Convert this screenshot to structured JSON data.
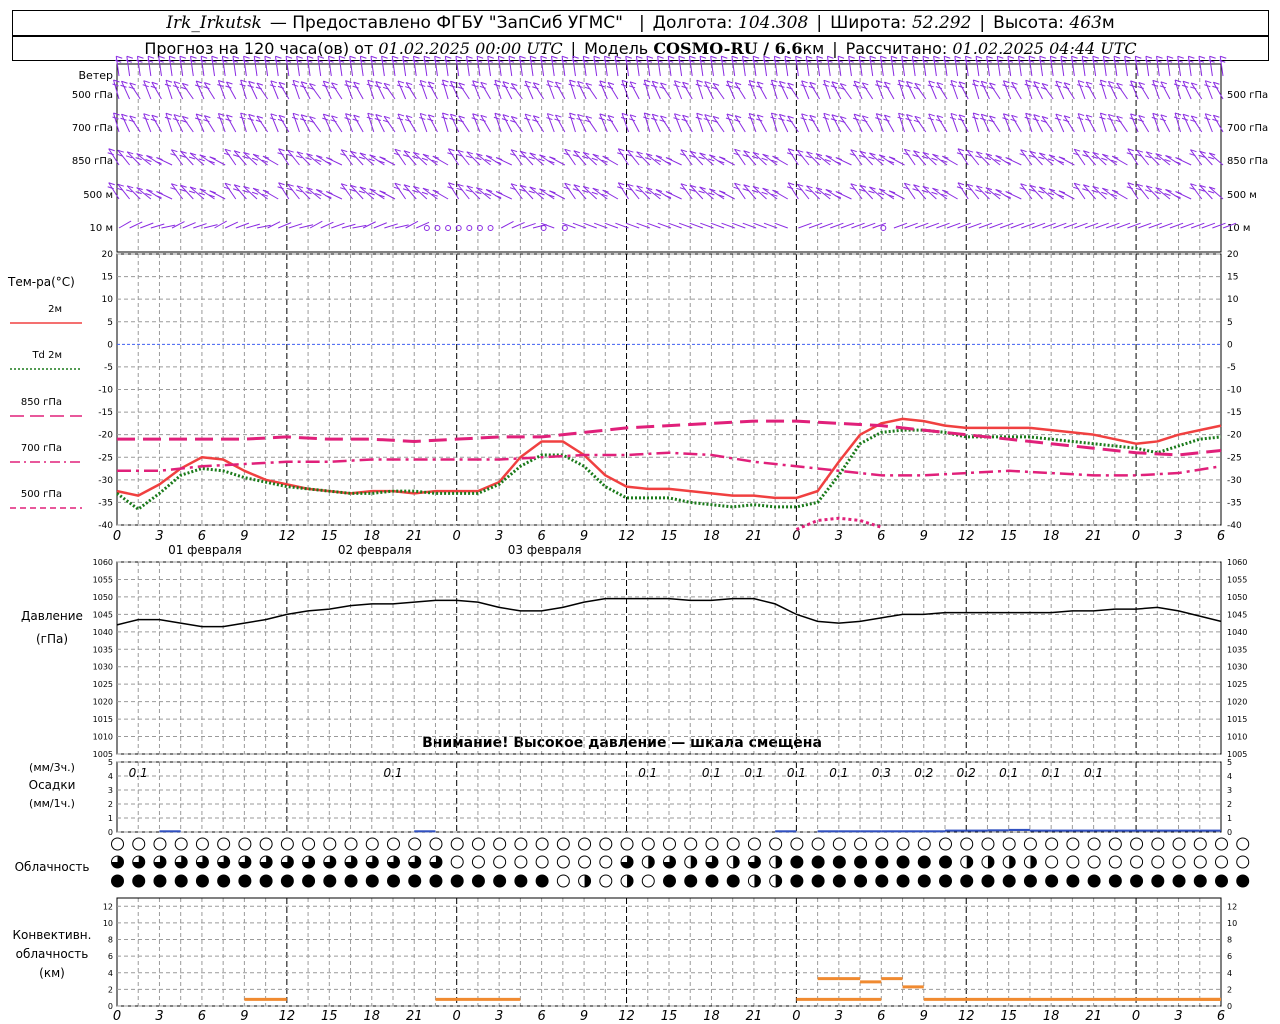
{
  "header": {
    "station": "Irk_Irkutsk",
    "provider": "— Предоставлено ФГБУ \"ЗапСиб УГМС\"",
    "lon_label": "Долгота:",
    "lon_value": "104.308",
    "lat_label": "Широта:",
    "lat_value": "52.292",
    "alt_label": "Высота:",
    "alt_value": "463",
    "alt_unit": "м",
    "forecast_label": "Прогноз на 120 часа(ов) от",
    "forecast_start": "01.02.2025 00:00 UTC",
    "model_label": "Модель",
    "model_value": "COSMO-RU / 6.6",
    "model_unit": "км",
    "computed_label": "Рассчитано:",
    "computed_value": "01.02.2025 04:44 UTC"
  },
  "colors": {
    "t2m": "#f04040",
    "td2m": "#1a7a1a",
    "t850": "#e0207a",
    "t700": "#e0207a",
    "t500": "#e0207a",
    "wind": "#8a2be2",
    "zero_line": "#4060f0",
    "pressure": "#000000",
    "precip": "#3050c0",
    "convective": "#f08a30"
  },
  "wind_panel": {
    "title": "Ветер",
    "levels": [
      "500 гПа",
      "700 гПа",
      "850 гПа",
      "500 м",
      "10  м"
    ],
    "levels_right": [
      "500 гПа",
      "700 гПа",
      "850 гПа",
      "500 м",
      "10  м"
    ]
  },
  "temp_panel": {
    "title": "Тем-ра(°C)",
    "legend": [
      {
        "label": "2м",
        "style": "solid",
        "color_key": "t2m"
      },
      {
        "label": "Td  2м",
        "style": "dotted",
        "color_key": "td2m"
      },
      {
        "label": "850 гПа",
        "style": "long-dash",
        "color_key": "t850"
      },
      {
        "label": "700 гПа",
        "style": "dash-dot",
        "color_key": "t700"
      },
      {
        "label": "500 гПа",
        "style": "dashed",
        "color_key": "t500"
      }
    ],
    "yticks": [
      "20",
      "15",
      "10",
      "5",
      "0",
      "-5",
      "-10",
      "-15",
      "-20",
      "-25",
      "-30",
      "-35",
      "-40"
    ],
    "day_labels": [
      "01 февраля",
      "02 февраля",
      "03 февраля"
    ]
  },
  "pressure_panel": {
    "title": "Давление",
    "unit": "(гПа)",
    "yticks": [
      "1060",
      "1055",
      "1050",
      "1045",
      "1040",
      "1035",
      "1030",
      "1025",
      "1020",
      "1015",
      "1010",
      "1005"
    ],
    "warning": "Внимание! Высокое давление — шкала смещена"
  },
  "precip_panel": {
    "unit_3h": "(мм/3ч.)",
    "title": "Осадки",
    "unit_1h": "(мм/1ч.)",
    "yticks": [
      "5",
      "4",
      "3",
      "2",
      "1",
      "0"
    ],
    "labels": [
      {
        "hour": 3,
        "text": "0.1"
      },
      {
        "hour": 39,
        "text": "0.1"
      },
      {
        "hour": 75,
        "text": "0.1"
      },
      {
        "hour": 84,
        "text": "0.1"
      },
      {
        "hour": 90,
        "text": "0.1"
      },
      {
        "hour": 96,
        "text": "0.1"
      },
      {
        "hour": 102,
        "text": "0.1"
      },
      {
        "hour": 108,
        "text": "0.3"
      },
      {
        "hour": 114,
        "text": "0.2"
      },
      {
        "hour": 120,
        "text": "0.2"
      },
      {
        "hour": 126,
        "text": "0.1"
      },
      {
        "hour": 132,
        "text": "0.1"
      },
      {
        "hour": 138,
        "text": "0.1"
      }
    ]
  },
  "cloud_panel": {
    "title": "Облачность"
  },
  "conv_panel": {
    "title_1": "Конвективн.",
    "title_2": "облачность",
    "unit": "(км)",
    "yticks": [
      "12",
      "10",
      "8",
      "6",
      "4",
      "2",
      "0"
    ]
  },
  "x_axis": {
    "hour_labels": [
      "0",
      "3",
      "6",
      "9",
      "12",
      "15",
      "18",
      "21",
      "0",
      "3",
      "6",
      "9",
      "12",
      "15",
      "18",
      "21",
      "0",
      "3",
      "6",
      "9",
      "12",
      "15",
      "18",
      "21",
      "0",
      "3",
      "6"
    ]
  },
  "chart_data": {
    "type": "line",
    "title": "Прогноз на 120 часа(ов) от 01.02.2025 00:00 UTC",
    "x_unit": "hours since 01.02.2025 00:00 UTC",
    "xlim": [
      0,
      156
    ],
    "temperature": {
      "ylim": [
        -40,
        20
      ],
      "series": [
        {
          "name": "2м",
          "x": [
            0,
            3,
            6,
            9,
            12,
            15,
            18,
            21,
            24,
            27,
            30,
            33,
            36,
            39,
            42,
            45,
            48,
            51,
            54,
            57,
            60,
            63,
            66,
            69,
            72,
            75,
            78,
            81,
            84,
            87,
            90,
            93,
            96,
            99,
            102,
            105,
            108,
            111,
            114,
            117,
            120,
            123,
            126,
            129,
            132,
            135,
            138,
            141,
            144,
            147,
            150,
            153,
            156
          ],
          "y": [
            -32.5,
            -33.5,
            -31,
            -27.5,
            -25,
            -25.5,
            -28,
            -30,
            -31,
            -32,
            -32.5,
            -33,
            -32.5,
            -32.5,
            -33,
            -32.5,
            -32.5,
            -32.5,
            -30.5,
            -25,
            -21.5,
            -21.5,
            -24.5,
            -29,
            -31.5,
            -32,
            -32,
            -32.5,
            -33,
            -33.5,
            -33.5,
            -34,
            -34,
            -32.5,
            -26,
            -20,
            -17.5,
            -16.5,
            -17,
            -18,
            -18.5,
            -18.5,
            -18.5,
            -18.5,
            -19,
            -19.5,
            -20,
            -21,
            -22,
            -21.5,
            -20,
            -19,
            -18
          ]
        },
        {
          "name": "Td 2м",
          "x": [
            0,
            3,
            6,
            9,
            12,
            15,
            18,
            21,
            24,
            27,
            30,
            33,
            36,
            39,
            42,
            45,
            48,
            51,
            54,
            57,
            60,
            63,
            66,
            69,
            72,
            75,
            78,
            81,
            84,
            87,
            90,
            93,
            96,
            99,
            102,
            105,
            108,
            111,
            114,
            117,
            120,
            123,
            126,
            129,
            132,
            135,
            138,
            141,
            144,
            147,
            150,
            153,
            156
          ],
          "y": [
            -33,
            -36.5,
            -33,
            -29,
            -27.5,
            -28,
            -29.5,
            -30.5,
            -31.5,
            -32,
            -32.5,
            -33,
            -33,
            -32.5,
            -32.5,
            -33,
            -33,
            -33,
            -31,
            -27,
            -24.5,
            -24.5,
            -27,
            -31.5,
            -34,
            -34,
            -34,
            -35,
            -35.5,
            -36,
            -35.5,
            -36,
            -36,
            -35,
            -29,
            -22,
            -19.5,
            -19,
            -19,
            -19.5,
            -20.5,
            -20.5,
            -20.5,
            -20.5,
            -21,
            -21.5,
            -22,
            -22.5,
            -23,
            -24,
            -22.5,
            -21,
            -20.5
          ]
        },
        {
          "name": "850 гПа",
          "x": [
            0,
            6,
            12,
            18,
            24,
            30,
            36,
            42,
            48,
            54,
            60,
            66,
            72,
            78,
            84,
            90,
            96,
            102,
            108,
            114,
            120,
            126,
            132,
            138,
            144,
            150,
            156
          ],
          "y": [
            -21,
            -21,
            -21,
            -21,
            -20.5,
            -21,
            -21,
            -21.5,
            -21,
            -20.5,
            -20.5,
            -19.5,
            -18.5,
            -18,
            -17.5,
            -17,
            -17,
            -17.5,
            -18,
            -19,
            -20,
            -21,
            -22,
            -23,
            -24,
            -24.5,
            -23.5
          ]
        },
        {
          "name": "700 гПа",
          "x": [
            0,
            6,
            12,
            18,
            24,
            30,
            36,
            42,
            48,
            54,
            60,
            66,
            72,
            78,
            84,
            90,
            96,
            102,
            108,
            114,
            120,
            126,
            132,
            138,
            144,
            150,
            156
          ],
          "y": [
            -28,
            -28,
            -27,
            -26.5,
            -26,
            -26,
            -25.5,
            -25.5,
            -25.5,
            -25.5,
            -25,
            -24.5,
            -24.5,
            -24,
            -24.5,
            -26,
            -27,
            -28,
            -29,
            -29,
            -28.5,
            -28,
            -28.5,
            -29,
            -29,
            -28.5,
            -27
          ]
        },
        {
          "name": "500 гПа",
          "x": [
            96,
            99,
            102,
            105,
            108
          ],
          "y": [
            -41,
            -39,
            -38.5,
            -39,
            -40.5
          ]
        }
      ]
    },
    "pressure": {
      "ylim": [
        1005,
        1060
      ],
      "series": [
        {
          "name": "Давление",
          "x": [
            0,
            3,
            6,
            9,
            12,
            15,
            18,
            21,
            24,
            27,
            30,
            33,
            36,
            39,
            42,
            45,
            48,
            51,
            54,
            57,
            60,
            63,
            66,
            69,
            72,
            75,
            78,
            81,
            84,
            87,
            90,
            93,
            96,
            99,
            102,
            105,
            108,
            111,
            114,
            117,
            120,
            123,
            126,
            129,
            132,
            135,
            138,
            141,
            144,
            147,
            150,
            153,
            156
          ],
          "y": [
            1042,
            1043.5,
            1043.5,
            1042.5,
            1041.5,
            1041.5,
            1042.5,
            1043.5,
            1045,
            1046,
            1046.5,
            1047.5,
            1048,
            1048,
            1048.5,
            1049,
            1049,
            1048.5,
            1047,
            1046,
            1046,
            1047,
            1048.5,
            1049.5,
            1049.5,
            1049.5,
            1049.5,
            1049,
            1049,
            1049.5,
            1049.5,
            1048,
            1045,
            1043,
            1042.5,
            1043,
            1044,
            1045,
            1045,
            1045.5,
            1045.5,
            1045.5,
            1045.5,
            1045.5,
            1045.5,
            1046,
            1046,
            1046.5,
            1046.5,
            1047,
            1046,
            1044.5,
            1043
          ]
        }
      ]
    },
    "precipitation": {
      "unit": "мм/1ч.",
      "ylim": [
        0,
        5
      ],
      "series": [
        {
          "name": "Осадки",
          "x": [
            0,
            3,
            6,
            9,
            12,
            15,
            18,
            21,
            24,
            27,
            30,
            33,
            36,
            39,
            42,
            45,
            48,
            51,
            54,
            57,
            60,
            63,
            66,
            69,
            72,
            75,
            78,
            81,
            84,
            87,
            90,
            93,
            96,
            99,
            102,
            105,
            108,
            111,
            114,
            117,
            120,
            123,
            126,
            129,
            132,
            135,
            138,
            141,
            144,
            147,
            150,
            153,
            156
          ],
          "y": [
            0,
            0,
            0.05,
            0,
            0,
            0,
            0,
            0,
            0,
            0,
            0,
            0,
            0,
            0,
            0.05,
            0,
            0,
            0,
            0,
            0,
            0,
            0,
            0,
            0,
            0,
            0,
            0,
            0,
            0,
            0,
            0,
            0.05,
            0,
            0.05,
            0.05,
            0.05,
            0.05,
            0.05,
            0.05,
            0.1,
            0.1,
            0.12,
            0.15,
            0.1,
            0.1,
            0.1,
            0.1,
            0.1,
            0.1,
            0.1,
            0.1,
            0.1,
            0
          ]
        }
      ]
    },
    "convective_cloud": {
      "unit": "км",
      "ylim": [
        0,
        13
      ],
      "series": [
        {
          "name": "Конвективная облачность",
          "segments": [
            [
              18,
              24,
              0.8
            ],
            [
              45,
              57,
              0.8
            ],
            [
              96,
              99,
              0.8
            ],
            [
              99,
              102,
              0.8
            ],
            [
              102,
              108,
              0.8
            ],
            [
              153,
              156,
              0.8
            ],
            [
              99,
              102,
              3.3
            ],
            [
              102,
              105,
              3.3
            ],
            [
              105,
              108,
              2.9
            ],
            [
              108,
              111,
              3.3
            ],
            [
              111,
              114,
              2.3
            ],
            [
              114,
              156,
              0.8
            ]
          ]
        }
      ]
    },
    "cloud_cover": {
      "rows": [
        {
          "x_count": 54,
          "values": [
            0,
            0,
            0,
            0,
            0,
            0,
            0,
            0,
            0,
            0,
            0,
            0,
            0,
            0,
            0,
            0,
            0,
            0,
            0,
            0,
            0,
            0,
            0,
            0,
            0,
            0,
            0,
            0,
            0,
            0,
            0,
            0,
            0,
            0,
            0,
            0,
            0,
            0,
            0,
            0,
            0,
            0,
            0,
            0,
            0,
            0,
            0,
            0,
            0,
            0,
            0,
            0,
            0,
            0,
            0,
            0,
            0,
            0,
            0,
            0,
            0,
            0,
            0,
            0,
            0,
            0,
            0,
            0,
            0,
            0,
            0,
            0,
            0,
            0,
            0,
            0,
            0,
            0,
            0,
            0,
            0,
            0,
            0,
            0,
            0,
            0,
            0,
            0,
            0,
            0,
            0,
            0,
            0,
            0,
            0,
            0,
            0,
            0,
            0,
            0,
            0,
            0,
            0,
            0,
            0,
            0,
            0,
            0,
            0,
            0,
            0,
            0,
            0,
            0,
            0,
            0,
            0,
            0,
            0,
            0,
            0,
            0,
            0,
            0,
            0,
            0,
            0,
            0,
            0,
            0,
            0,
            0,
            0,
            0,
            0,
            0,
            0,
            0,
            0,
            0,
            0,
            0,
            0,
            0,
            0,
            0,
            0,
            0,
            0,
            0,
            0,
            0,
            0
          ]
        },
        {
          "x_count": 54
        },
        {
          "x_count": 54
        }
      ]
    }
  }
}
